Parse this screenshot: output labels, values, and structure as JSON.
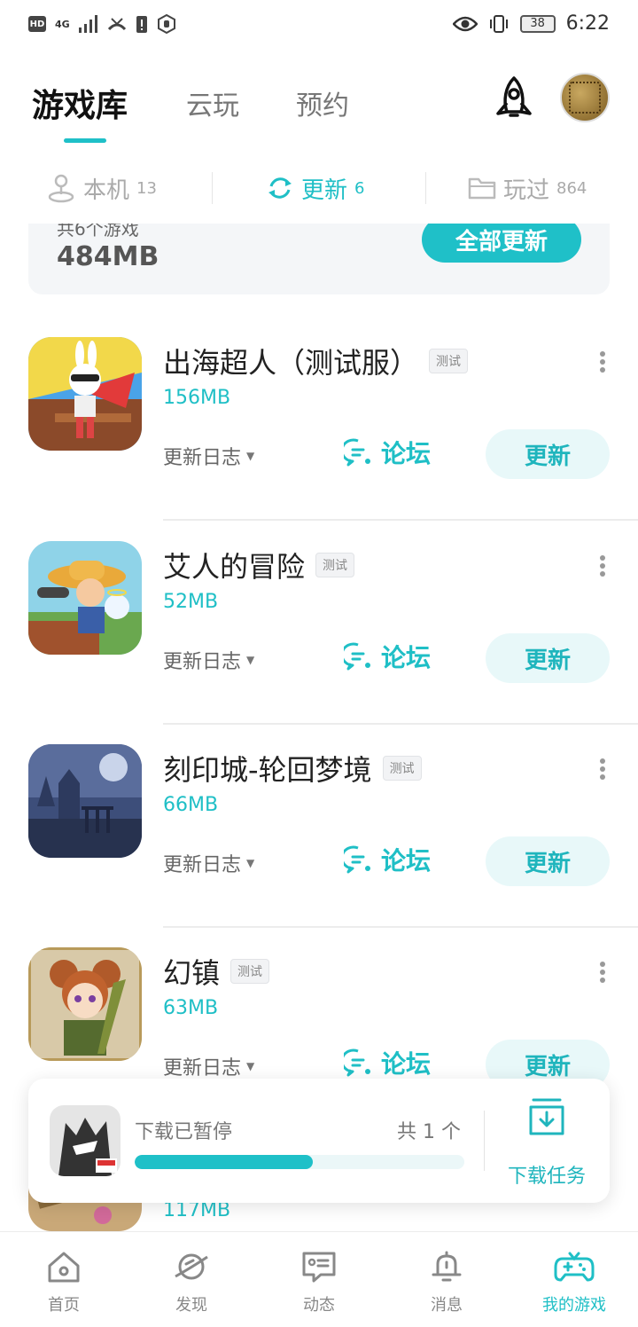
{
  "status_bar": {
    "hd": "HD",
    "signal": "4G",
    "battery": "38",
    "time": "6:22"
  },
  "header": {
    "tabs": [
      {
        "label": "游戏库",
        "active": true
      },
      {
        "label": "云玩",
        "active": false
      },
      {
        "label": "预约",
        "active": false
      }
    ],
    "rocket_icon": "rocket-icon",
    "accent_color": "#1fc0c8"
  },
  "subtabs": [
    {
      "label": "本机",
      "count": "13",
      "icon": "joystick-icon"
    },
    {
      "label": "更新",
      "count": "6",
      "icon": "refresh-icon",
      "active": true
    },
    {
      "label": "玩过",
      "count": "864",
      "icon": "folder-icon"
    }
  ],
  "summary": {
    "partial_text": "共6个游戏",
    "total_size": "484MB",
    "update_all_label": "全部更新"
  },
  "games": [
    {
      "name": "出海超人（测试服）",
      "badge": "测试",
      "size": "156MB",
      "changelog": "更新日志",
      "forum": "论坛",
      "update": "更新"
    },
    {
      "name": "艾人的冒险",
      "badge": "测试",
      "size": "52MB",
      "changelog": "更新日志",
      "forum": "论坛",
      "update": "更新"
    },
    {
      "name": "刻印城-轮回梦境",
      "badge": "测试",
      "size": "66MB",
      "changelog": "更新日志",
      "forum": "论坛",
      "update": "更新"
    },
    {
      "name": "幻镇",
      "badge": "测试",
      "size": "63MB",
      "changelog": "更新日志",
      "forum": "论坛",
      "update": "更新"
    }
  ],
  "partial_game": {
    "size": "117MB"
  },
  "download_bar": {
    "status": "下载已暂停",
    "count": "共 1 个",
    "progress": 0.54,
    "task_label": "下载任务"
  },
  "bottom_nav": [
    {
      "label": "首页",
      "icon": "home-icon"
    },
    {
      "label": "发现",
      "icon": "planet-icon"
    },
    {
      "label": "动态",
      "icon": "chat-card-icon"
    },
    {
      "label": "消息",
      "icon": "bell-icon"
    },
    {
      "label": "我的游戏",
      "icon": "gamepad-icon",
      "active": true
    }
  ]
}
